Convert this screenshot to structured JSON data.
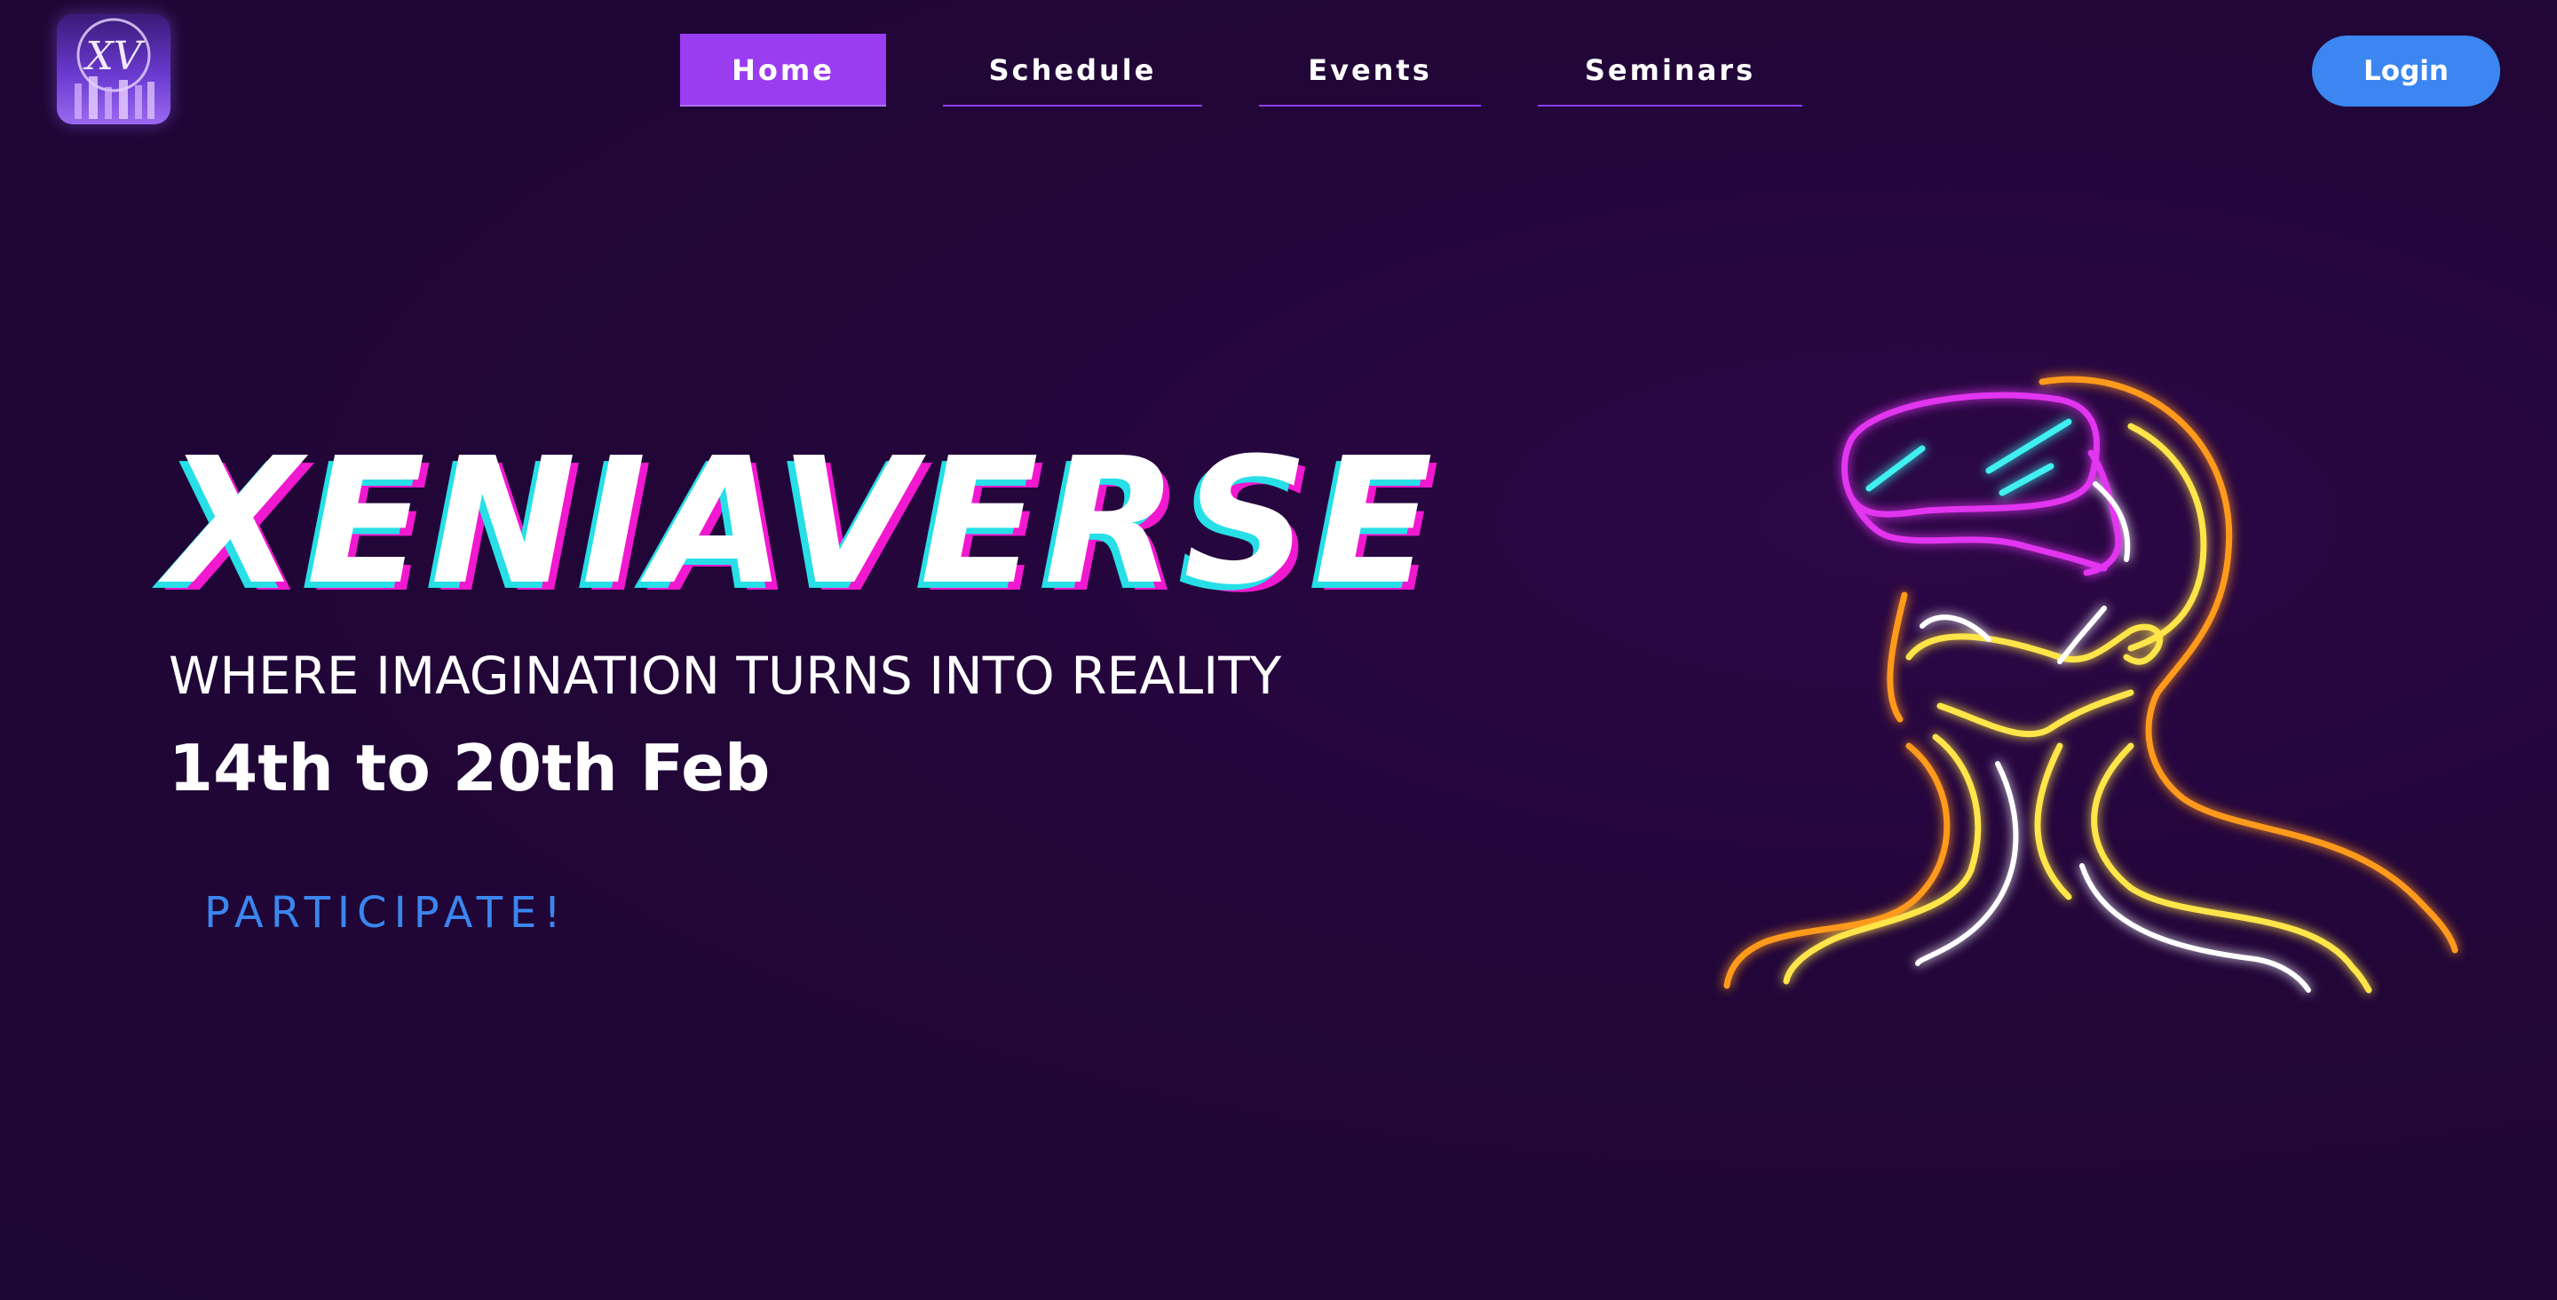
{
  "nav": {
    "items": [
      {
        "label": "Home",
        "active": true
      },
      {
        "label": "Schedule",
        "active": false
      },
      {
        "label": "Events",
        "active": false
      },
      {
        "label": "Seminars",
        "active": false
      }
    ],
    "login_label": "Login"
  },
  "logo": {
    "icon": "xv-logo-icon"
  },
  "hero": {
    "title": "XENIAVERSE",
    "tagline": "WHERE IMAGINATION TURNS INTO REALITY",
    "dates": "14th to 20th Feb",
    "cta_label": "PARTICIPATE!"
  },
  "illustration": {
    "icon": "neon-vr-head-icon"
  },
  "colors": {
    "background": "#22063a",
    "nav_active": "#9a3df0",
    "nav_underline": "#8b3cf0",
    "login_button": "#3b86f0",
    "cta_text": "#3a86ef",
    "title_shadow_cyan": "#27dfe6",
    "title_shadow_magenta": "#f019d0",
    "neon_magenta": "#e234f0",
    "neon_orange": "#ff9a1e",
    "neon_yellow": "#ffe54a",
    "neon_cyan": "#3ff0f0"
  }
}
